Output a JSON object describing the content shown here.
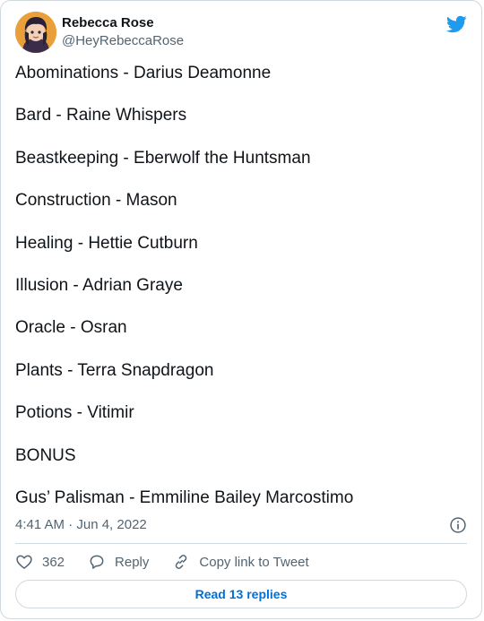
{
  "tweet": {
    "author": {
      "display_name": "Rebecca Rose",
      "handle": "@HeyRebeccaRose",
      "avatar_icon": "cartoon-avatar"
    },
    "brand_icon": "twitter-bird-icon",
    "brand_color": "#1d9bf0",
    "lines": [
      "Abominations - Darius Deamonne",
      "Bard - Raine Whispers",
      "Beastkeeping - Eberwolf the Huntsman",
      "Construction - Mason",
      "Healing - Hettie Cutburn",
      "Illusion - Adrian Graye",
      "Oracle - Osran",
      "Plants - Terra Snapdragon",
      "Potions - Vitimir",
      "BONUS",
      "Gus’ Palisman - Emmiline Bailey Marcostimo"
    ],
    "timestamp": "4:41 AM · Jun 4, 2022",
    "actions": {
      "like_count": "362",
      "reply_label": "Reply",
      "copy_label": "Copy link to Tweet"
    },
    "read_replies_label": "Read 13 replies",
    "link_color": "#006fd6"
  }
}
